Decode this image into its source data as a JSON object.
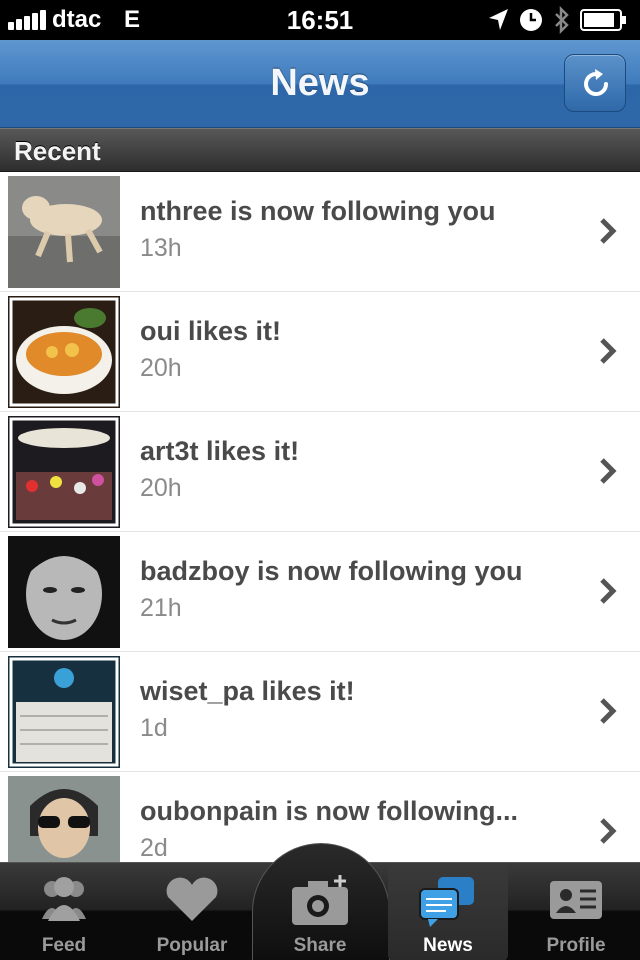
{
  "status_bar": {
    "carrier": "dtac",
    "network": "E",
    "time": "16:51",
    "icons": [
      "signal-icon",
      "location-arrow-icon",
      "clock-icon",
      "bluetooth-icon",
      "battery-icon"
    ]
  },
  "nav": {
    "title": "News",
    "refresh_icon": "refresh-icon",
    "accent_color": "#3f7bbd"
  },
  "section": {
    "title": "Recent"
  },
  "items": [
    {
      "title": "nthree is now following you",
      "time": "13h",
      "thumb": "dog-photo"
    },
    {
      "title": "oui likes it!",
      "time": "20h",
      "thumb": "food-photo"
    },
    {
      "title": "art3t likes it!",
      "time": "20h",
      "thumb": "crowd-photo"
    },
    {
      "title": "badzboy is now following you",
      "time": "21h",
      "thumb": "portrait-photo"
    },
    {
      "title": "wiset_pa likes it!",
      "time": "1d",
      "thumb": "event-photo"
    },
    {
      "title": "oubonpain is now following...",
      "time": "2d",
      "thumb": "selfie-photo"
    }
  ],
  "tabs": [
    {
      "label": "Feed",
      "icon": "people-icon"
    },
    {
      "label": "Popular",
      "icon": "heart-icon"
    },
    {
      "label": "Share",
      "icon": "camera-icon"
    },
    {
      "label": "News",
      "icon": "speech-bubbles-icon",
      "active": true
    },
    {
      "label": "Profile",
      "icon": "id-card-icon"
    }
  ]
}
